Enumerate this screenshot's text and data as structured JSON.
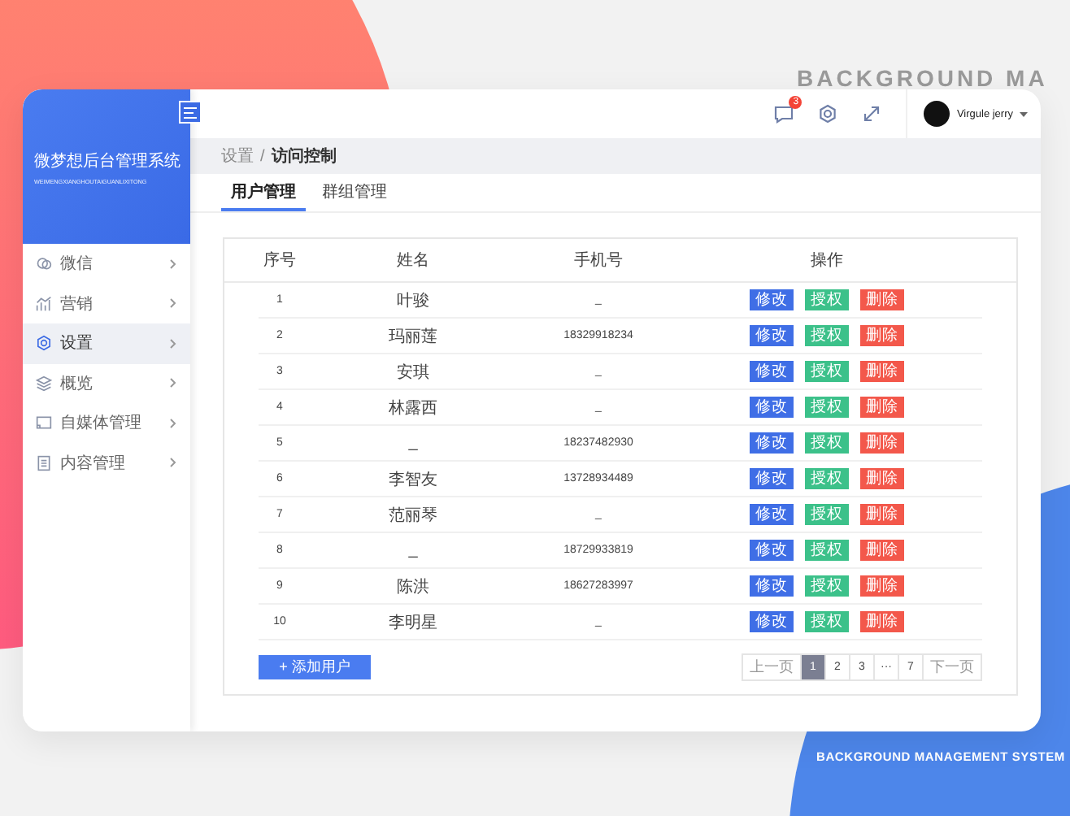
{
  "backdrop": {
    "headline": "BACKGROUND MA",
    "tagline": "BACKGROUND MANAGEMENT SYSTEM"
  },
  "sidebar": {
    "title": "微梦想后台管理系统",
    "subtitle": "WEIMENGXIANGHOUTAIGUANLIXITONG",
    "items": [
      {
        "label": "微信",
        "kind": "chat",
        "selected": false
      },
      {
        "label": "营销",
        "kind": "chart",
        "selected": false
      },
      {
        "label": "设置",
        "kind": "gear",
        "selected": true
      },
      {
        "label": "概览",
        "kind": "layers",
        "selected": false
      },
      {
        "label": "自媒体管理",
        "kind": "screen",
        "selected": false
      },
      {
        "label": "内容管理",
        "kind": "doc",
        "selected": false
      }
    ]
  },
  "topbar": {
    "notifications": "3",
    "user": "Virgule jerry"
  },
  "breadcrumb": {
    "items": [
      "设置",
      "访问控制"
    ],
    "separator": "/"
  },
  "tabs": [
    {
      "label": "用户管理",
      "selected": true
    },
    {
      "label": "群组管理",
      "selected": false
    }
  ],
  "table": {
    "columns": [
      "序号",
      "姓名",
      "手机号",
      "操作"
    ],
    "rows": [
      {
        "cells": [
          "1",
          "叶骏",
          "_"
        ],
        "actions": [
          "修改",
          "授权",
          "删除"
        ]
      },
      {
        "cells": [
          "2",
          "玛丽莲",
          "18329918234"
        ],
        "actions": [
          "修改",
          "授权",
          "删除"
        ]
      },
      {
        "cells": [
          "3",
          "安琪",
          "_"
        ],
        "actions": [
          "修改",
          "授权",
          "删除"
        ]
      },
      {
        "cells": [
          "4",
          "林露西",
          "_"
        ],
        "actions": [
          "修改",
          "授权",
          "删除"
        ]
      },
      {
        "cells": [
          "5",
          "_",
          "18237482930"
        ],
        "actions": [
          "修改",
          "授权",
          "删除"
        ]
      },
      {
        "cells": [
          "6",
          "李智友",
          "13728934489"
        ],
        "actions": [
          "修改",
          "授权",
          "删除"
        ]
      },
      {
        "cells": [
          "7",
          "范丽琴",
          "_"
        ],
        "actions": [
          "修改",
          "授权",
          "删除"
        ]
      },
      {
        "cells": [
          "8",
          "_",
          "18729933819"
        ],
        "actions": [
          "修改",
          "授权",
          "删除"
        ]
      },
      {
        "cells": [
          "9",
          "陈洪",
          "18627283997"
        ],
        "actions": [
          "修改",
          "授权",
          "删除"
        ]
      },
      {
        "cells": [
          "10",
          "李明星",
          "_"
        ],
        "actions": [
          "修改",
          "授权",
          "删除"
        ]
      }
    ]
  },
  "add_button": "+ 添加用户",
  "pagination": {
    "prev": "上一页",
    "pages": [
      {
        "label": "1",
        "selected": true
      },
      {
        "label": "2",
        "selected": false
      },
      {
        "label": "3",
        "selected": false
      },
      {
        "label": "···",
        "selected": false
      },
      {
        "label": "7",
        "selected": false
      }
    ],
    "next": "下一页"
  }
}
